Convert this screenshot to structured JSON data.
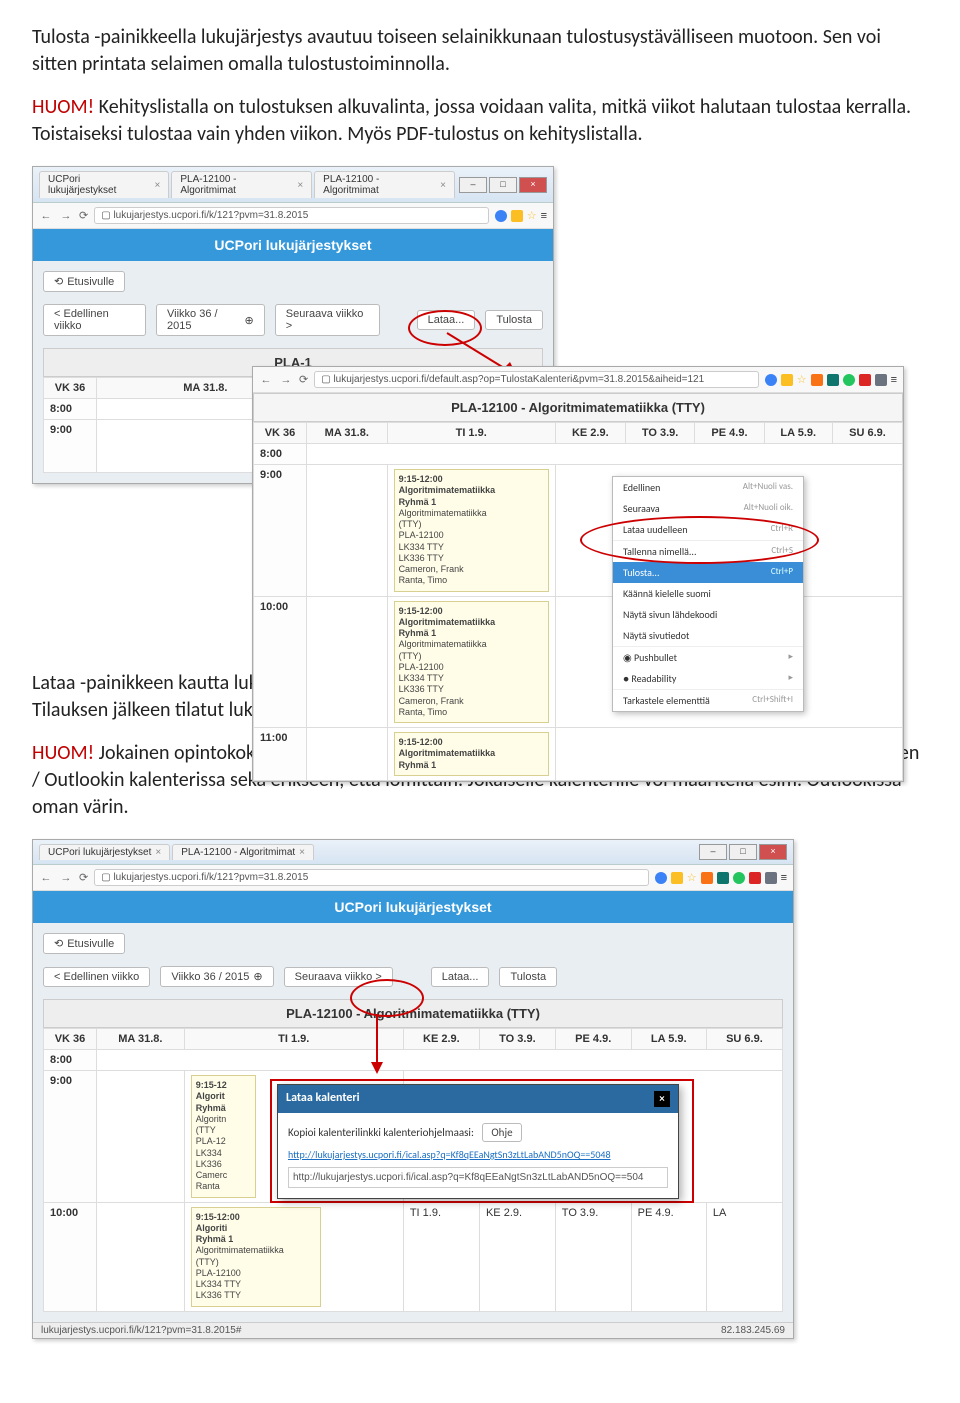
{
  "doc": {
    "p1": "Tulosta -painikkeella lukujärjestys avautuu toiseen selainikkunaan tulostusystävälliseen muotoon. Sen voi sitten printata selaimen omalla tulostustoiminnolla.",
    "huom1_lead": "HUOM!",
    "huom1_text": " Kehityslistalla on tulostuksen alkuvalinta, jossa voidaan valita, mitkä viikot halutaan tulostaa kerralla. Toistaiseksi tulostaa vain yhden viikon. Myös PDF-tulostus on kehityslistalla.",
    "p2": "Lataa -painikkeen kautta lukujärjestyksen voi tilata ns. iCal-formaatissa omaan älypuhelimeen / Outlookkiin. Tilauksen jälkeen tilatut lukujärjestykset päivittyvät älypuhelimeen automaattisesti.",
    "huom2_lead": "HUOM!",
    "huom2_text": " Jokainen opintokokonaisuus / kurssi pitää tilata erikseen ja aikataulut saa näkymään matkapuhelimen / Outlookin kalenterissa sekä erikseen, että lomittain. Jokaiselle kalenterille voi määritellä esim. Outlookissa oman värin."
  },
  "common": {
    "app_title": "UCPori lukujärjestykset",
    "etusivulle": "Etusivulle",
    "prev_week": "< Edellinen viikko",
    "week_36": "Viikko 36 / 2015",
    "next_week": "Seuraava viikko >",
    "lataa": "Lataa...",
    "tulosta": "Tulosta",
    "course_title": "PLA-12100 - Algoritmimatematiikka (TTY)",
    "course_title_short": "PLA-1",
    "url1": "lukujarjestys.ucpori.fi/k/121?pvm=31.8.2015",
    "url_print": "lukujarjestys.ucpori.fi/default.asp?op=TulostaKalenteri&pvm=31.8.2015&aiheid=121",
    "tab1": "UCPori lukujärjestykset",
    "tab2": "PLA-12100 - Algoritmimat",
    "tab3": "PLA-12100 - Algoritmimat"
  },
  "sched": {
    "vk36": "VK 36",
    "days": [
      "MA 31.8.",
      "TI 1.9.",
      "KE 2.9.",
      "TO 3.9.",
      "PE 4.9.",
      "LA 5.9.",
      "SU 6.9."
    ],
    "hours": [
      "8:00",
      "9:00",
      "10:00",
      "11:00"
    ],
    "event": {
      "time": "9:15-12:00",
      "line1": "Algoritmimatematiikka",
      "line2": "Ryhmä 1",
      "line3": "Algoritmimatematiikka",
      "line4": "(TTY)",
      "line5": "PLA-12100",
      "line6": "LK334 TTY",
      "line7": "LK336 TTY",
      "line8": "Cameron, Frank",
      "line9": "Ranta, Timo"
    },
    "event_trunc": {
      "time": "9:15-12:00",
      "line1": "Algoritmimatematiikka",
      "line2": "Ryhmä 1"
    },
    "event_tiny": {
      "time": "9:15-1",
      "line1": "Algoritm",
      "line2": "Ryhmä"
    }
  },
  "ctx": {
    "r1": "Edellinen",
    "r1s": "Alt+Nuoli vas.",
    "r2": "Seuraava",
    "r2s": "Alt+Nuoli oik.",
    "r3": "Lataa uudelleen",
    "r3s": "Ctrl+R",
    "r4": "Tallenna nimellä...",
    "r4s": "Ctrl+S",
    "r5": "Tulosta...",
    "r5s": "Ctrl+P",
    "r6": "Käännä kielelle suomi",
    "r7": "Näytä sivun lähdekoodi",
    "r8": "Näytä sivutiedot",
    "r9": "Pushbullet",
    "r10": "Readability",
    "r11": "Tarkastele elementtiä",
    "r11s": "Ctrl+Shift+I"
  },
  "dlg": {
    "title": "Lataa kalenteri",
    "instr": "Kopioi kalenterilinkki kalenteriohjelmaasi:",
    "ohje": "Ohje",
    "link": "http://lukujarjestys.ucpori.fi/ical.asp?q=Kf8qEEaNgtSn3zLtLabAND5nOQ==5048",
    "input": "http://lukujarjestys.ucpori.fi/ical.asp?q=Kf8qEEaNgtSn3zLtLabAND5nOQ==504"
  },
  "status": {
    "left": "lukujarjestys.ucpori.fi/k/121?pvm=31.8.2015#",
    "right": "82.183.245.69"
  },
  "days_short": {
    "ma": "MA 31.8.",
    "ti": "TI 1.9.",
    "ke": "KE 2.9.",
    "to": "TO 3.9.",
    "pe": "PE 4.9.",
    "la": "LA"
  }
}
